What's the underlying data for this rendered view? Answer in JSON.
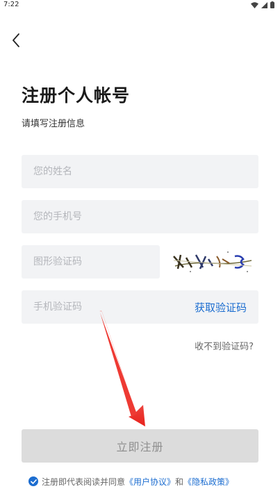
{
  "status_bar": {
    "time": "7:22"
  },
  "header": {
    "title": "注册个人帐号",
    "subtitle": "请填写注册信息"
  },
  "form": {
    "name_placeholder": "您的姓名",
    "phone_placeholder": "您的手机号",
    "captcha_placeholder": "图形验证码",
    "sms_placeholder": "手机验证码",
    "get_code_label": "获取验证码",
    "no_code_label": "收不到验证码?",
    "submit_label": "立即注册"
  },
  "agreement": {
    "prefix": "注册即代表阅读并同意",
    "user_agreement": "《用户协议》",
    "and": "和",
    "privacy_policy": "《隐私政策》",
    "checked": true
  },
  "colors": {
    "accent": "#1c6dd0",
    "field_bg": "#f2f3f5",
    "button_disabled": "#dcdcdc",
    "annotation_arrow": "#f0463c"
  }
}
